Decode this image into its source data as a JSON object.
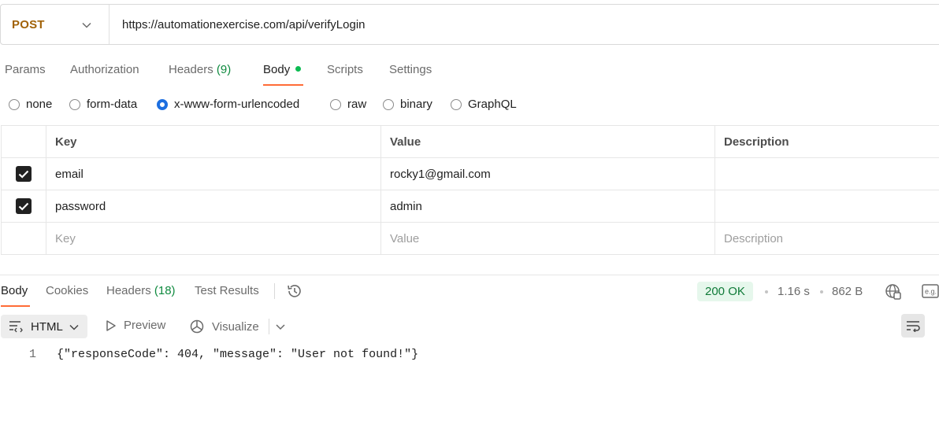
{
  "request": {
    "method": "POST",
    "url": "https://automationexercise.com/api/verifyLogin"
  },
  "request_tabs": [
    {
      "label": "Params"
    },
    {
      "label": "Authorization"
    },
    {
      "label": "Headers",
      "count": "(9)"
    },
    {
      "label": "Body",
      "active": true,
      "indicator": "green-dot"
    },
    {
      "label": "Scripts"
    },
    {
      "label": "Settings"
    }
  ],
  "body_types": [
    {
      "label": "none",
      "checked": false
    },
    {
      "label": "form-data",
      "checked": false
    },
    {
      "label": "x-www-form-urlencoded",
      "checked": true
    },
    {
      "label": "raw",
      "checked": false
    },
    {
      "label": "binary",
      "checked": false
    },
    {
      "label": "GraphQL",
      "checked": false
    }
  ],
  "params_table": {
    "headers": [
      "Key",
      "Value",
      "Description"
    ],
    "rows": [
      {
        "checked": true,
        "key": "email",
        "value": "rocky1@gmail.com",
        "description": ""
      },
      {
        "checked": true,
        "key": "password",
        "value": "admin",
        "description": ""
      }
    ],
    "placeholder": {
      "key": "Key",
      "value": "Value",
      "description": "Description"
    }
  },
  "response_tabs": [
    {
      "label": "Body",
      "active": true
    },
    {
      "label": "Cookies"
    },
    {
      "label": "Headers",
      "count": "(18)"
    },
    {
      "label": "Test Results"
    }
  ],
  "response_status": {
    "status": "200 OK",
    "time": "1.16 s",
    "size": "862 B"
  },
  "response_toolbar": {
    "format": "HTML",
    "preview": "Preview",
    "visualize": "Visualize"
  },
  "response_body": {
    "line_number": "1",
    "code": "{\"responseCode\": 404, \"message\": \"User not found!\"}"
  },
  "colors": {
    "method": "#a16207",
    "accent_tab": "#ff6c37",
    "status_bg": "#e6f7ec",
    "status_text": "#0f7a38",
    "count_green": "#0f8a3f",
    "radio_blue": "#1d6fe0"
  }
}
